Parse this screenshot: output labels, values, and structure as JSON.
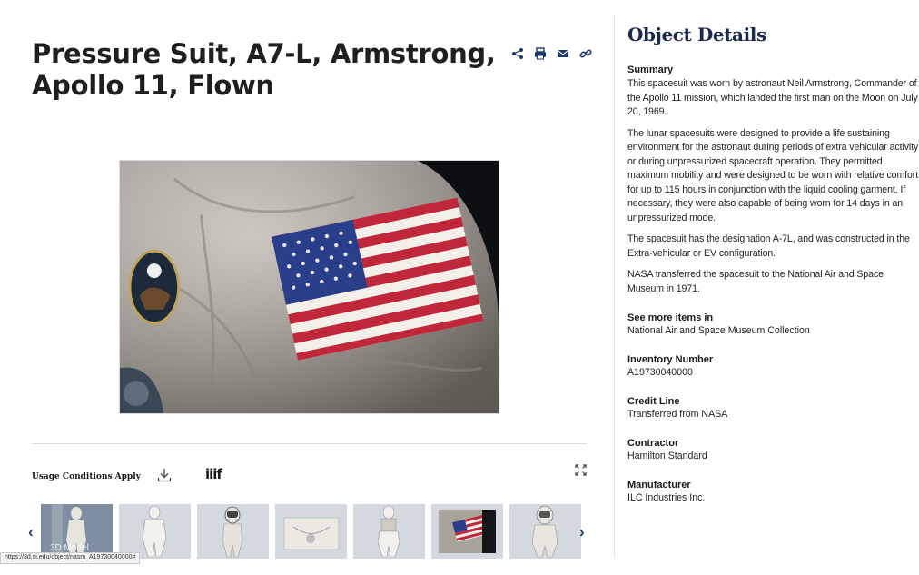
{
  "object": {
    "title": "Pressure Suit, A7-L, Armstrong, Apollo 11, Flown"
  },
  "share_icons": [
    "share-icon",
    "print-icon",
    "email-icon",
    "link-icon"
  ],
  "media": {
    "usage_label": "Usage Conditions Apply",
    "iiif_label": "iiif",
    "thumbnail_overlay": "3D Model",
    "thumbnail_count": 7
  },
  "status_bar": {
    "url": "https://3d.si.edu/object/nasm_A19730040000#"
  },
  "details": {
    "heading": "Object Details",
    "summary_label": "Summary",
    "summary_paragraphs": [
      "This spacesuit was worn by astronaut Neil Armstrong, Commander of the Apollo 11 mission, which landed the first man on the Moon on July 20, 1969.",
      "The lunar spacesuits were designed to provide a life sustaining environment for the astronaut during periods of extra vehicular activity or during unpressurized spacecraft operation. They permitted maximum mobility and were designed to be worn with relative comfort for up to 115 hours in conjunction with the liquid cooling garment. If necessary, they were also capable of being worn for 14 days in an unpressurized mode.",
      "The spacesuit has the designation A-7L, and was constructed in the Extra-vehicular or EV configuration.",
      "NASA transferred the spacesuit to the National Air and Space Museum in 1971."
    ],
    "fields": [
      {
        "label": "See more items in",
        "value": "National Air and Space Museum Collection"
      },
      {
        "label": "Inventory Number",
        "value": "A19730040000"
      },
      {
        "label": "Credit Line",
        "value": "Transferred from NASA"
      },
      {
        "label": "Contractor",
        "value": "Hamilton Standard"
      },
      {
        "label": "Manufacturer",
        "value": "ILC Industries Inc."
      }
    ]
  },
  "colors": {
    "accent": "#1b3a6b",
    "heading": "#1b2a4a"
  }
}
